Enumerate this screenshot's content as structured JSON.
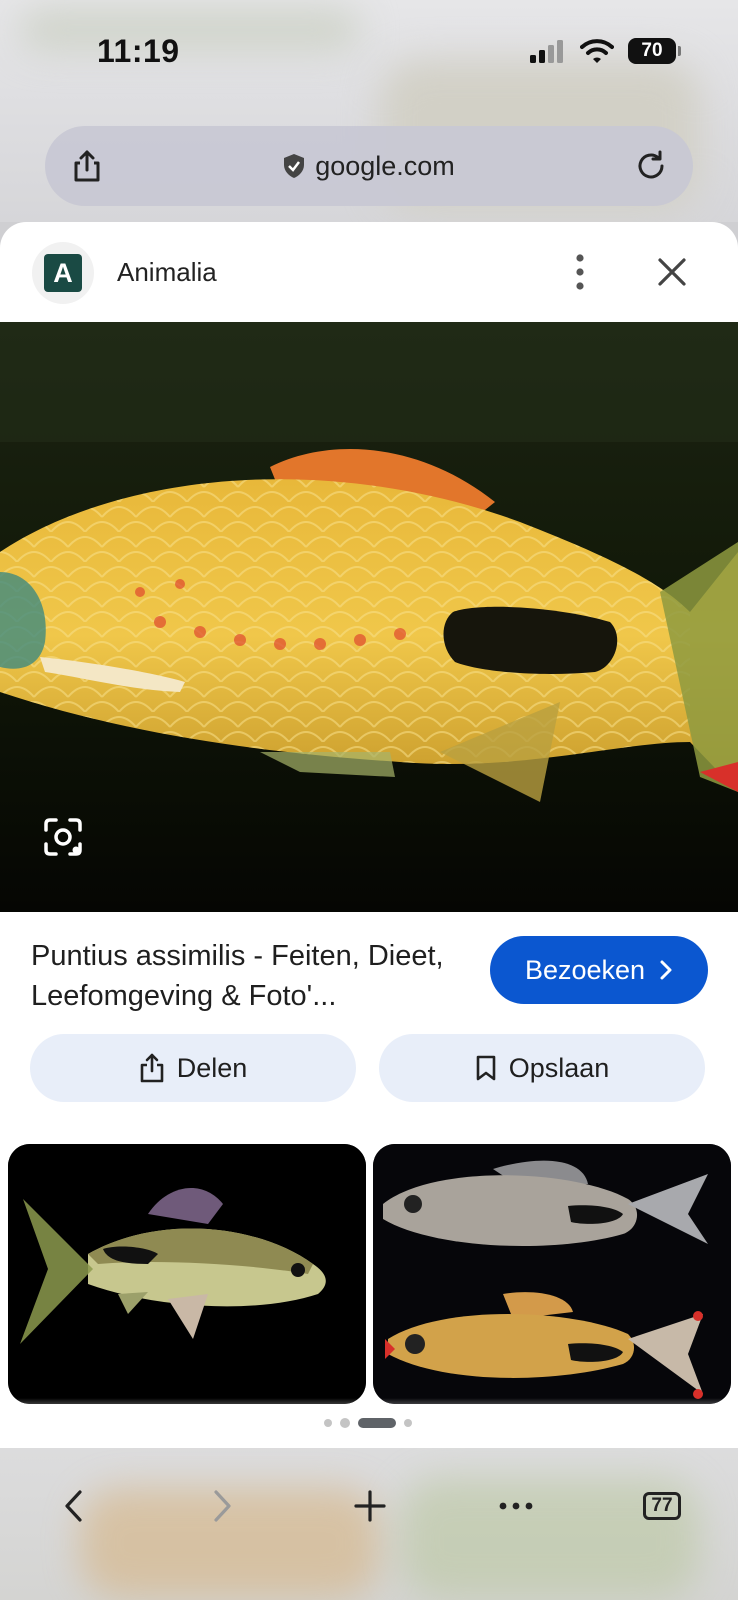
{
  "status_bar": {
    "time": "11:19",
    "battery": "70"
  },
  "url_bar": {
    "domain": "google.com"
  },
  "sheet": {
    "site_initial": "A",
    "site_name": "Animalia",
    "result_title": "Puntius assimilis - Feiten, Dieet, Leefomgeving & Foto'...",
    "visit_label": "Bezoeken",
    "share_label": "Delen",
    "save_label": "Opslaan",
    "pager": {
      "count": 4,
      "active_index": 2
    }
  },
  "bottom_toolbar": {
    "tab_count": "77"
  },
  "colors": {
    "accent": "#0b57d0",
    "pill_bg": "#e8eef9",
    "avatar_bg": "#1a4a44"
  },
  "icons": [
    "share-icon",
    "shield-icon",
    "reload-icon",
    "more-vert-icon",
    "close-icon",
    "lens-icon",
    "chevron-right-icon",
    "bookmark-icon",
    "back-icon",
    "forward-icon",
    "plus-icon",
    "more-horiz-icon",
    "tabs-icon"
  ]
}
